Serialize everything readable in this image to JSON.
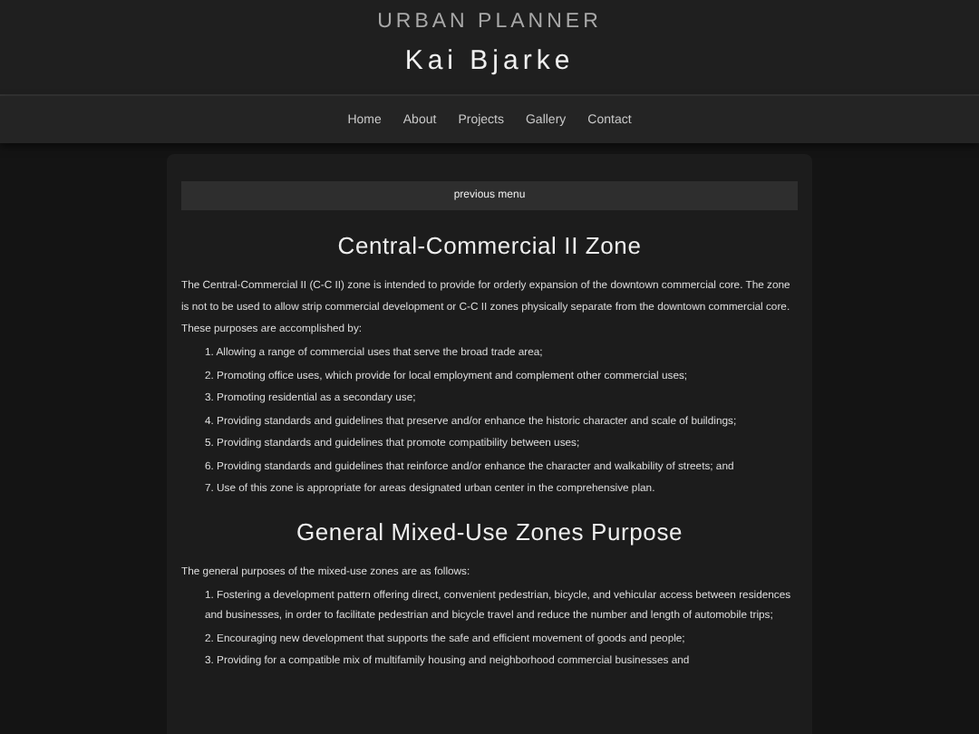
{
  "header": {
    "subtitle": "URBAN PLANNER",
    "name": "Kai Bjarke"
  },
  "nav": [
    "Home",
    "About",
    "Projects",
    "Gallery",
    "Contact"
  ],
  "menu_bar": {
    "label": "previous menu"
  },
  "sections": [
    {
      "heading": "Central-Commercial II Zone",
      "intro": "The Central-Commercial II (C-C II) zone is intended to provide for orderly expansion of the downtown commercial core. The zone is not to be used to allow strip commercial development or C-C II zones physically separate from the downtown commercial core. These purposes are accomplished by:",
      "items": [
        "1. Allowing a range of commercial uses that serve the broad trade area;",
        "2. Promoting office uses, which provide for local employment and complement other commercial uses;",
        "3. Promoting residential as a secondary use;",
        "4. Providing standards and guidelines that preserve and/or enhance the historic character and scale of buildings;",
        "5. Providing standards and guidelines that promote compatibility between uses;",
        "6. Providing standards and guidelines that reinforce and/or enhance the character and walkability of streets; and",
        "7. Use of this zone is appropriate for areas designated urban center in the comprehensive plan."
      ]
    },
    {
      "heading": "General Mixed-Use Zones Purpose",
      "intro": "The general purposes of the mixed-use zones are as follows:",
      "items": [
        "1. Fostering a development pattern offering direct, convenient pedestrian, bicycle, and vehicular access between residences and businesses, in order to facilitate pedestrian and bicycle travel and reduce the number and length of automobile trips;",
        "2. Encouraging new development that supports the safe and efficient movement of goods and people;",
        "3. Providing for a compatible mix of multifamily housing and neighborhood commercial businesses and"
      ]
    }
  ]
}
